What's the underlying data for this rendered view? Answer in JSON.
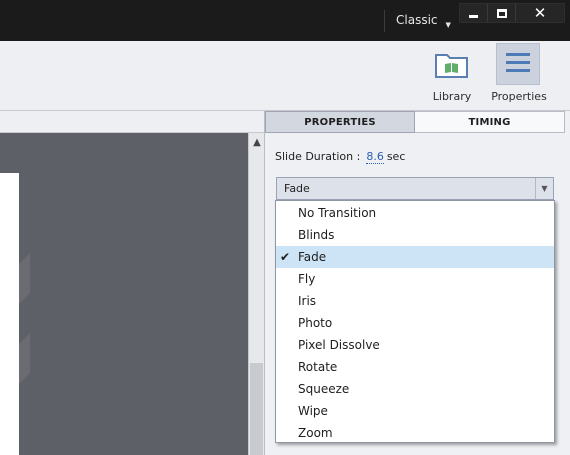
{
  "titlebar": {
    "workspace_label": "Classic",
    "window_buttons": {
      "minimize": "minimize-icon",
      "maximize": "maximize-icon",
      "close": "close-icon"
    }
  },
  "toolbar": {
    "library_label": "Library",
    "properties_label": "Properties"
  },
  "panel": {
    "tabs": [
      {
        "label": "PROPERTIES",
        "active": true
      },
      {
        "label": "TIMING",
        "active": false
      }
    ],
    "slide_duration": {
      "label": "Slide Duration :",
      "value": "8.6",
      "unit": "sec"
    },
    "transition_select": {
      "selected": "Fade"
    }
  },
  "dropdown": {
    "options": [
      {
        "label": "No Transition",
        "checked": false
      },
      {
        "label": "Blinds",
        "checked": false
      },
      {
        "label": "Fade",
        "checked": true
      },
      {
        "label": "Fly",
        "checked": false
      },
      {
        "label": "Iris",
        "checked": false
      },
      {
        "label": "Photo",
        "checked": false
      },
      {
        "label": "Pixel Dissolve",
        "checked": false
      },
      {
        "label": "Rotate",
        "checked": false
      },
      {
        "label": "Squeeze",
        "checked": false
      },
      {
        "label": "Wipe",
        "checked": false
      },
      {
        "label": "Zoom",
        "checked": false
      }
    ]
  },
  "colors": {
    "accent_value": "#2a5fb0",
    "selection_highlight": "#cde4f7",
    "titlebar_bg": "#1b1b1b",
    "canvas_bg": "#5e6067",
    "icon_blue": "#5a7fb0",
    "icon_green": "#5fae6a"
  }
}
